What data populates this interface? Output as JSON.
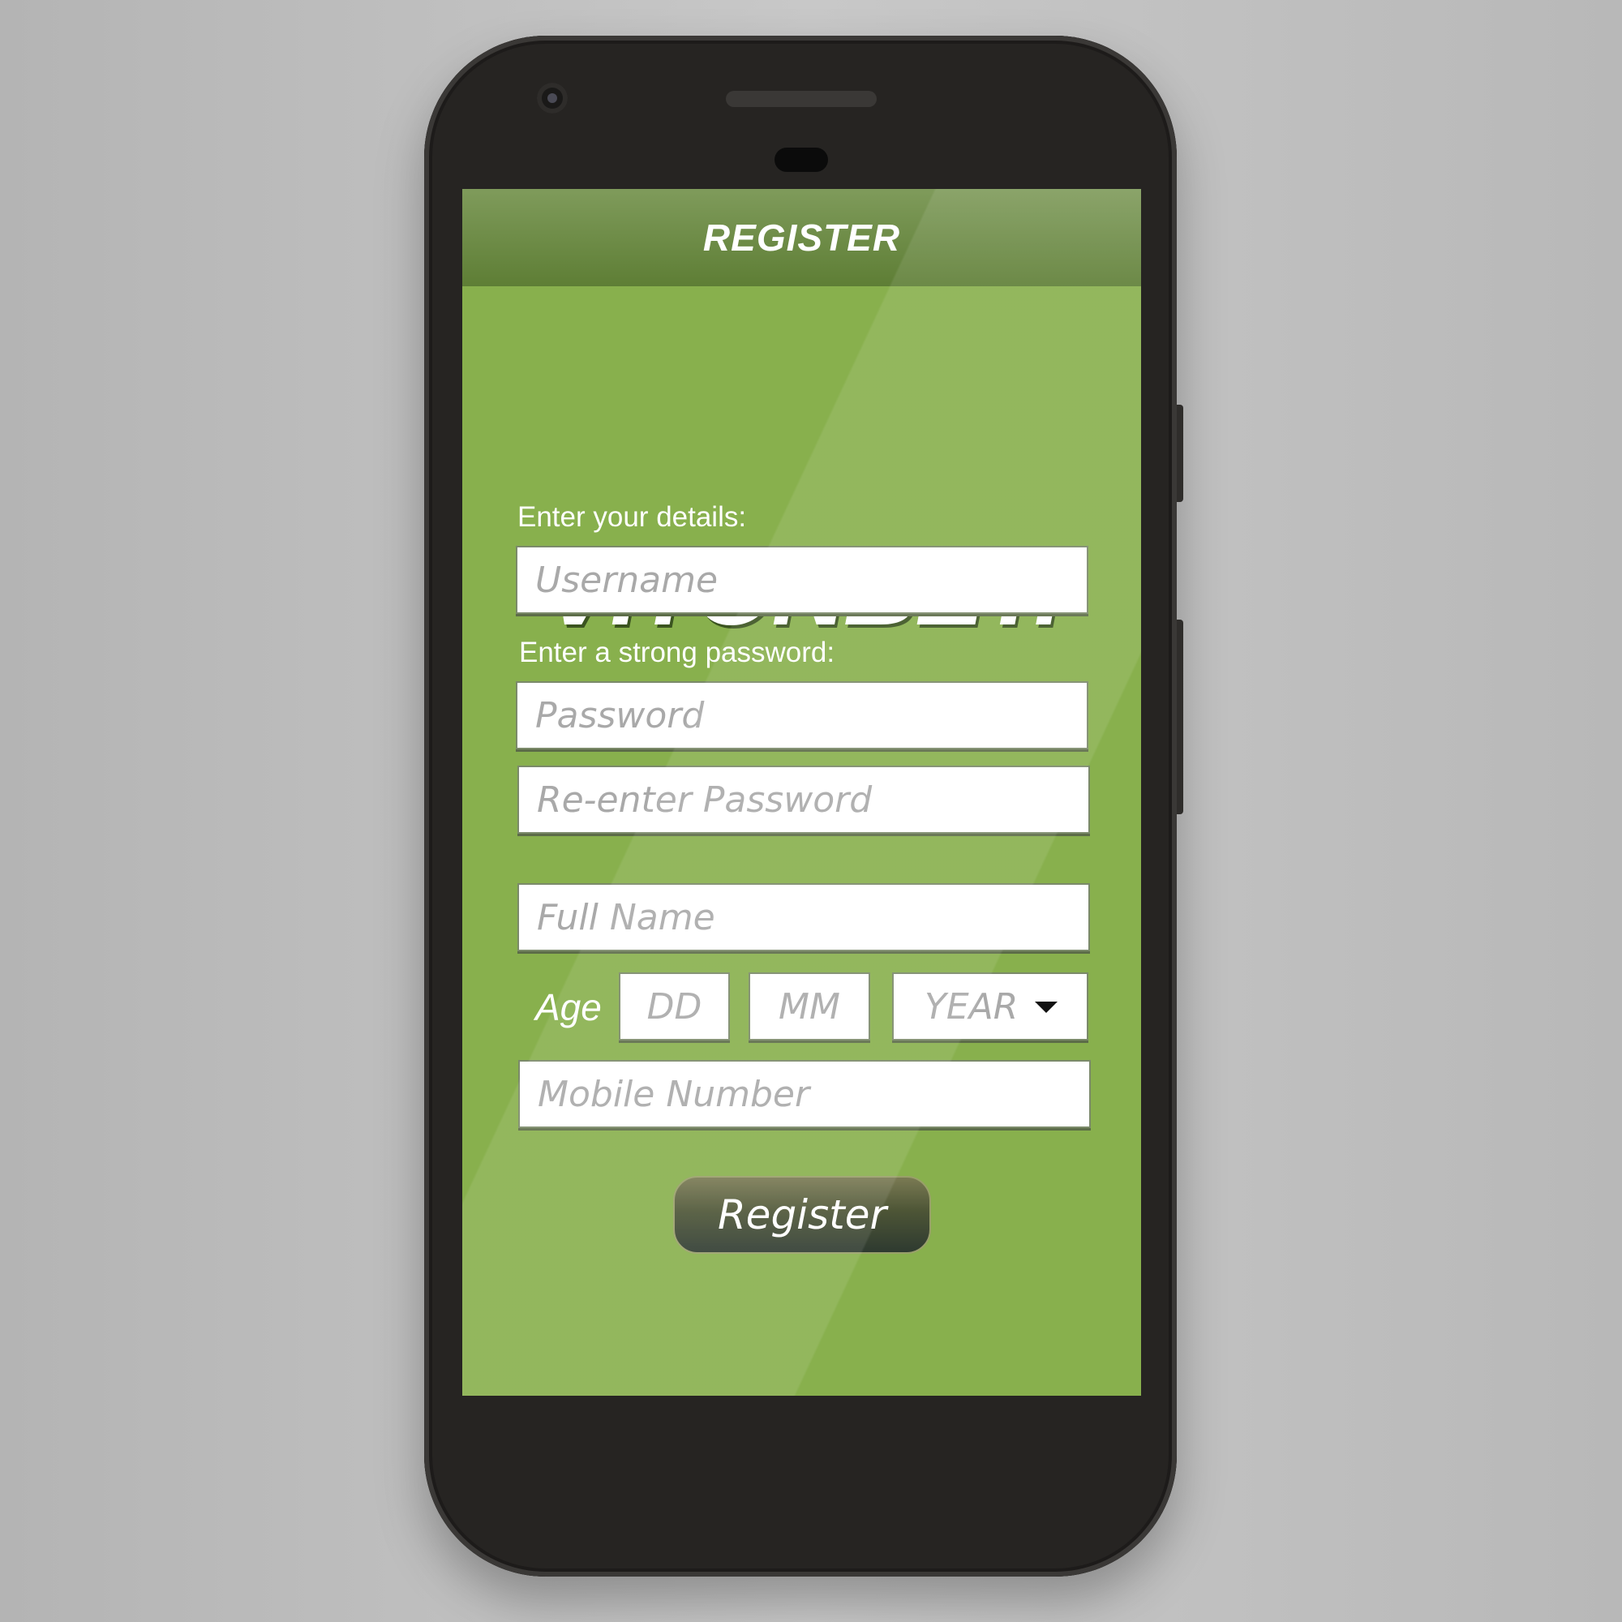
{
  "header": {
    "title": "REGISTER"
  },
  "brand": {
    "logo_text": "VITONBET."
  },
  "form": {
    "details_label": "Enter your details:",
    "username_placeholder": "Username",
    "password_label": "Enter a strong password:",
    "password_placeholder": "Password",
    "reenter_password_placeholder": "Re-enter Password",
    "full_name_placeholder": "Full Name",
    "age_label": "Age",
    "day_placeholder": "DD",
    "month_placeholder": "MM",
    "year_placeholder": "YEAR",
    "mobile_placeholder": "Mobile Number",
    "submit_label": "Register"
  },
  "icons": {
    "year_dropdown": "chevron-down-icon"
  },
  "colors": {
    "background": "#88b04d",
    "header": "#5e7e35",
    "button": "#2e3a30"
  }
}
